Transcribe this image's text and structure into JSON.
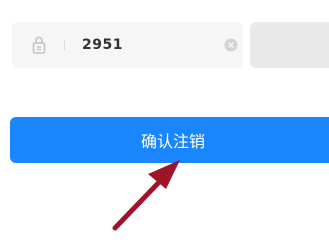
{
  "verification": {
    "code_value": "2951",
    "code_placeholder": "",
    "send_code_label": "",
    "lock_icon": "lock-icon",
    "clear_icon": "clear-icon"
  },
  "confirm": {
    "label": "确认注销"
  },
  "annotation": {
    "arrow_icon": "red-pointer-arrow"
  },
  "colors": {
    "primary": "#1a86fe",
    "field_bg": "#f6f6f6",
    "disabled_button": "#e9e9e9",
    "arrow": "#a0142a"
  }
}
